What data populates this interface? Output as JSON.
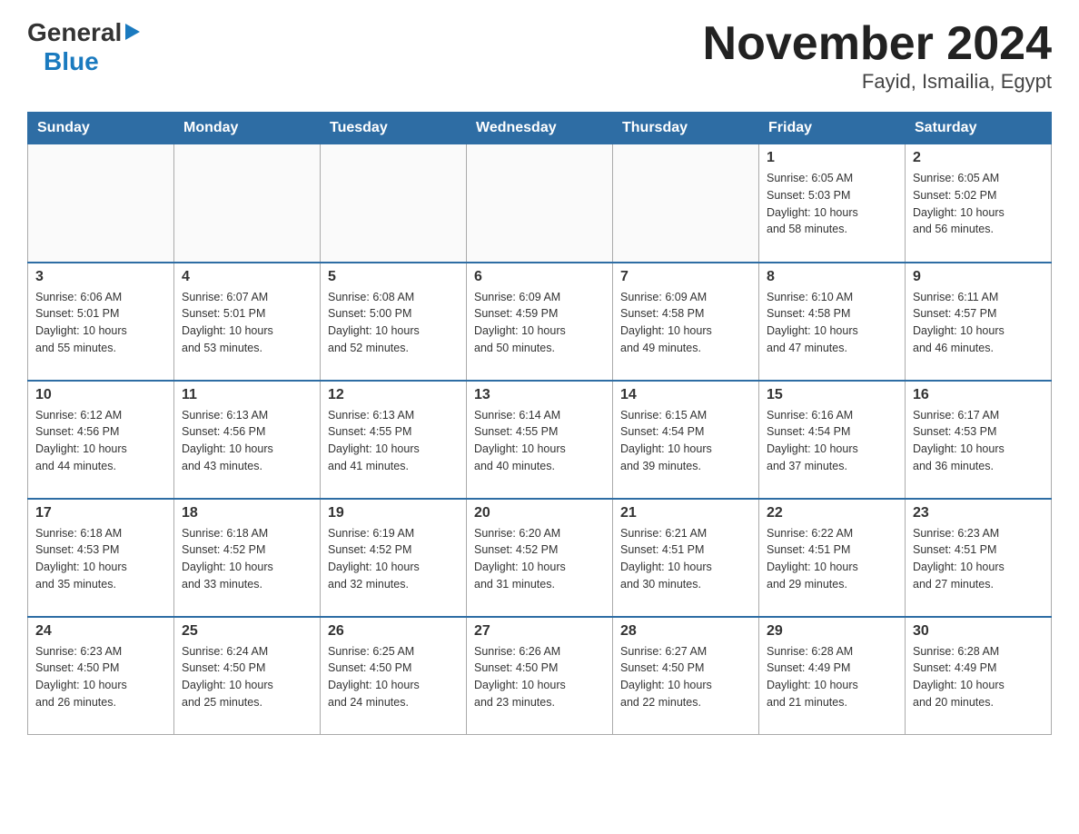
{
  "logo": {
    "general": "General",
    "blue": "Blue",
    "arrow": "▶"
  },
  "title": {
    "month_year": "November 2024",
    "location": "Fayid, Ismailia, Egypt"
  },
  "weekdays": [
    "Sunday",
    "Monday",
    "Tuesday",
    "Wednesday",
    "Thursday",
    "Friday",
    "Saturday"
  ],
  "rows": [
    {
      "cells": [
        {
          "day": "",
          "info": ""
        },
        {
          "day": "",
          "info": ""
        },
        {
          "day": "",
          "info": ""
        },
        {
          "day": "",
          "info": ""
        },
        {
          "day": "",
          "info": ""
        },
        {
          "day": "1",
          "info": "Sunrise: 6:05 AM\nSunset: 5:03 PM\nDaylight: 10 hours\nand 58 minutes."
        },
        {
          "day": "2",
          "info": "Sunrise: 6:05 AM\nSunset: 5:02 PM\nDaylight: 10 hours\nand 56 minutes."
        }
      ]
    },
    {
      "cells": [
        {
          "day": "3",
          "info": "Sunrise: 6:06 AM\nSunset: 5:01 PM\nDaylight: 10 hours\nand 55 minutes."
        },
        {
          "day": "4",
          "info": "Sunrise: 6:07 AM\nSunset: 5:01 PM\nDaylight: 10 hours\nand 53 minutes."
        },
        {
          "day": "5",
          "info": "Sunrise: 6:08 AM\nSunset: 5:00 PM\nDaylight: 10 hours\nand 52 minutes."
        },
        {
          "day": "6",
          "info": "Sunrise: 6:09 AM\nSunset: 4:59 PM\nDaylight: 10 hours\nand 50 minutes."
        },
        {
          "day": "7",
          "info": "Sunrise: 6:09 AM\nSunset: 4:58 PM\nDaylight: 10 hours\nand 49 minutes."
        },
        {
          "day": "8",
          "info": "Sunrise: 6:10 AM\nSunset: 4:58 PM\nDaylight: 10 hours\nand 47 minutes."
        },
        {
          "day": "9",
          "info": "Sunrise: 6:11 AM\nSunset: 4:57 PM\nDaylight: 10 hours\nand 46 minutes."
        }
      ]
    },
    {
      "cells": [
        {
          "day": "10",
          "info": "Sunrise: 6:12 AM\nSunset: 4:56 PM\nDaylight: 10 hours\nand 44 minutes."
        },
        {
          "day": "11",
          "info": "Sunrise: 6:13 AM\nSunset: 4:56 PM\nDaylight: 10 hours\nand 43 minutes."
        },
        {
          "day": "12",
          "info": "Sunrise: 6:13 AM\nSunset: 4:55 PM\nDaylight: 10 hours\nand 41 minutes."
        },
        {
          "day": "13",
          "info": "Sunrise: 6:14 AM\nSunset: 4:55 PM\nDaylight: 10 hours\nand 40 minutes."
        },
        {
          "day": "14",
          "info": "Sunrise: 6:15 AM\nSunset: 4:54 PM\nDaylight: 10 hours\nand 39 minutes."
        },
        {
          "day": "15",
          "info": "Sunrise: 6:16 AM\nSunset: 4:54 PM\nDaylight: 10 hours\nand 37 minutes."
        },
        {
          "day": "16",
          "info": "Sunrise: 6:17 AM\nSunset: 4:53 PM\nDaylight: 10 hours\nand 36 minutes."
        }
      ]
    },
    {
      "cells": [
        {
          "day": "17",
          "info": "Sunrise: 6:18 AM\nSunset: 4:53 PM\nDaylight: 10 hours\nand 35 minutes."
        },
        {
          "day": "18",
          "info": "Sunrise: 6:18 AM\nSunset: 4:52 PM\nDaylight: 10 hours\nand 33 minutes."
        },
        {
          "day": "19",
          "info": "Sunrise: 6:19 AM\nSunset: 4:52 PM\nDaylight: 10 hours\nand 32 minutes."
        },
        {
          "day": "20",
          "info": "Sunrise: 6:20 AM\nSunset: 4:52 PM\nDaylight: 10 hours\nand 31 minutes."
        },
        {
          "day": "21",
          "info": "Sunrise: 6:21 AM\nSunset: 4:51 PM\nDaylight: 10 hours\nand 30 minutes."
        },
        {
          "day": "22",
          "info": "Sunrise: 6:22 AM\nSunset: 4:51 PM\nDaylight: 10 hours\nand 29 minutes."
        },
        {
          "day": "23",
          "info": "Sunrise: 6:23 AM\nSunset: 4:51 PM\nDaylight: 10 hours\nand 27 minutes."
        }
      ]
    },
    {
      "cells": [
        {
          "day": "24",
          "info": "Sunrise: 6:23 AM\nSunset: 4:50 PM\nDaylight: 10 hours\nand 26 minutes."
        },
        {
          "day": "25",
          "info": "Sunrise: 6:24 AM\nSunset: 4:50 PM\nDaylight: 10 hours\nand 25 minutes."
        },
        {
          "day": "26",
          "info": "Sunrise: 6:25 AM\nSunset: 4:50 PM\nDaylight: 10 hours\nand 24 minutes."
        },
        {
          "day": "27",
          "info": "Sunrise: 6:26 AM\nSunset: 4:50 PM\nDaylight: 10 hours\nand 23 minutes."
        },
        {
          "day": "28",
          "info": "Sunrise: 6:27 AM\nSunset: 4:50 PM\nDaylight: 10 hours\nand 22 minutes."
        },
        {
          "day": "29",
          "info": "Sunrise: 6:28 AM\nSunset: 4:49 PM\nDaylight: 10 hours\nand 21 minutes."
        },
        {
          "day": "30",
          "info": "Sunrise: 6:28 AM\nSunset: 4:49 PM\nDaylight: 10 hours\nand 20 minutes."
        }
      ]
    }
  ]
}
